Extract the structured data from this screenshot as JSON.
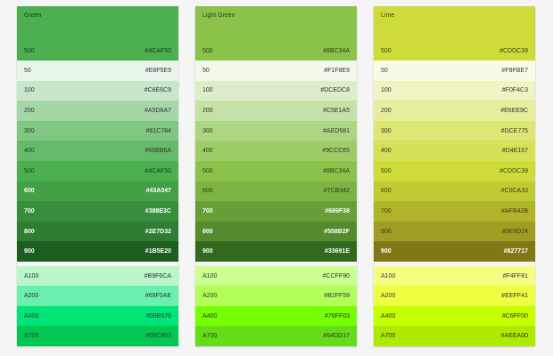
{
  "palettes": [
    {
      "name": "Green",
      "header": {
        "shade": "500",
        "hex": "#4CAF50",
        "bg": "#4CAF50",
        "fg": "#1b3a1c"
      },
      "swatches": [
        {
          "shade": "50",
          "hex": "#E8F5E9",
          "bg": "#E8F5E9",
          "fg": "#333333",
          "bold": false
        },
        {
          "shade": "100",
          "hex": "#C8E6C9",
          "bg": "#C8E6C9",
          "fg": "#333333",
          "bold": false
        },
        {
          "shade": "200",
          "hex": "#A5D6A7",
          "bg": "#A5D6A7",
          "fg": "#333333",
          "bold": false
        },
        {
          "shade": "300",
          "hex": "#81C784",
          "bg": "#81C784",
          "fg": "#333333",
          "bold": false
        },
        {
          "shade": "400",
          "hex": "#66BB6A",
          "bg": "#66BB6A",
          "fg": "#333333",
          "bold": false
        },
        {
          "shade": "500",
          "hex": "#4CAF50",
          "bg": "#4CAF50",
          "fg": "#1b3a1c",
          "bold": false
        },
        {
          "shade": "600",
          "hex": "#43A047",
          "bg": "#43A047",
          "fg": "#ffffff",
          "bold": true
        },
        {
          "shade": "700",
          "hex": "#388E3C",
          "bg": "#388E3C",
          "fg": "#ffffff",
          "bold": true
        },
        {
          "shade": "800",
          "hex": "#2E7D32",
          "bg": "#2E7D32",
          "fg": "#ffffff",
          "bold": true
        },
        {
          "shade": "900",
          "hex": "#1B5E20",
          "bg": "#1B5E20",
          "fg": "#ffffff",
          "bold": true
        }
      ],
      "accents": [
        {
          "shade": "A100",
          "hex": "#B9F6CA",
          "bg": "#B9F6CA",
          "fg": "#333333",
          "bold": false
        },
        {
          "shade": "A200",
          "hex": "#69F0AE",
          "bg": "#69F0AE",
          "fg": "#333333",
          "bold": false
        },
        {
          "shade": "A400",
          "hex": "#00E676",
          "bg": "#00E676",
          "fg": "#333333",
          "bold": false
        },
        {
          "shade": "A700",
          "hex": "#00C853",
          "bg": "#00C853",
          "fg": "#333333",
          "bold": false
        }
      ]
    },
    {
      "name": "Light Green",
      "header": {
        "shade": "500",
        "hex": "#8BC34A",
        "bg": "#8BC34A",
        "fg": "#2b3d17"
      },
      "swatches": [
        {
          "shade": "50",
          "hex": "#F1F8E9",
          "bg": "#F1F8E9",
          "fg": "#333333",
          "bold": false
        },
        {
          "shade": "100",
          "hex": "#DCEDC8",
          "bg": "#DCEDC8",
          "fg": "#333333",
          "bold": false
        },
        {
          "shade": "200",
          "hex": "#C5E1A5",
          "bg": "#C5E1A5",
          "fg": "#333333",
          "bold": false
        },
        {
          "shade": "300",
          "hex": "#AED581",
          "bg": "#AED581",
          "fg": "#333333",
          "bold": false
        },
        {
          "shade": "400",
          "hex": "#9CCC65",
          "bg": "#9CCC65",
          "fg": "#333333",
          "bold": false
        },
        {
          "shade": "500",
          "hex": "#8BC34A",
          "bg": "#8BC34A",
          "fg": "#2b3d17",
          "bold": false
        },
        {
          "shade": "600",
          "hex": "#7CB342",
          "bg": "#7CB342",
          "fg": "#2b3d17",
          "bold": false
        },
        {
          "shade": "700",
          "hex": "#689F38",
          "bg": "#689F38",
          "fg": "#ffffff",
          "bold": true
        },
        {
          "shade": "800",
          "hex": "#558B2F",
          "bg": "#558B2F",
          "fg": "#ffffff",
          "bold": true
        },
        {
          "shade": "900",
          "hex": "#33691E",
          "bg": "#33691E",
          "fg": "#ffffff",
          "bold": true
        }
      ],
      "accents": [
        {
          "shade": "A100",
          "hex": "#CCFF90",
          "bg": "#CCFF90",
          "fg": "#333333",
          "bold": false
        },
        {
          "shade": "A200",
          "hex": "#B2FF59",
          "bg": "#B2FF59",
          "fg": "#333333",
          "bold": false
        },
        {
          "shade": "A400",
          "hex": "#76FF03",
          "bg": "#76FF03",
          "fg": "#333333",
          "bold": false
        },
        {
          "shade": "A700",
          "hex": "#64DD17",
          "bg": "#64DD17",
          "fg": "#333333",
          "bold": false
        }
      ]
    },
    {
      "name": "Lime",
      "header": {
        "shade": "500",
        "hex": "#CDDC39",
        "bg": "#CDDC39",
        "fg": "#3d4211"
      },
      "swatches": [
        {
          "shade": "50",
          "hex": "#F9FBE7",
          "bg": "#F9FBE7",
          "fg": "#333333",
          "bold": false
        },
        {
          "shade": "100",
          "hex": "#F0F4C3",
          "bg": "#F0F4C3",
          "fg": "#333333",
          "bold": false
        },
        {
          "shade": "200",
          "hex": "#E6EE9C",
          "bg": "#E6EE9C",
          "fg": "#333333",
          "bold": false
        },
        {
          "shade": "300",
          "hex": "#DCE775",
          "bg": "#DCE775",
          "fg": "#333333",
          "bold": false
        },
        {
          "shade": "400",
          "hex": "#D4E157",
          "bg": "#D4E157",
          "fg": "#333333",
          "bold": false
        },
        {
          "shade": "500",
          "hex": "#CDDC39",
          "bg": "#CDDC39",
          "fg": "#3d4211",
          "bold": false
        },
        {
          "shade": "600",
          "hex": "#C0CA33",
          "bg": "#C0CA33",
          "fg": "#3d4211",
          "bold": false
        },
        {
          "shade": "700",
          "hex": "#AFB42B",
          "bg": "#AFB42B",
          "fg": "#3d4211",
          "bold": false
        },
        {
          "shade": "800",
          "hex": "#9E9D24",
          "bg": "#9E9D24",
          "fg": "#3d4211",
          "bold": false
        },
        {
          "shade": "900",
          "hex": "#827717",
          "bg": "#827717",
          "fg": "#ffffff",
          "bold": true
        }
      ],
      "accents": [
        {
          "shade": "A100",
          "hex": "#F4FF81",
          "bg": "#F4FF81",
          "fg": "#333333",
          "bold": false
        },
        {
          "shade": "A200",
          "hex": "#EEFF41",
          "bg": "#EEFF41",
          "fg": "#333333",
          "bold": false
        },
        {
          "shade": "A400",
          "hex": "#C6FF00",
          "bg": "#C6FF00",
          "fg": "#333333",
          "bold": false
        },
        {
          "shade": "A700",
          "hex": "#AEEA00",
          "bg": "#AEEA00",
          "fg": "#333333",
          "bold": false
        }
      ]
    }
  ]
}
